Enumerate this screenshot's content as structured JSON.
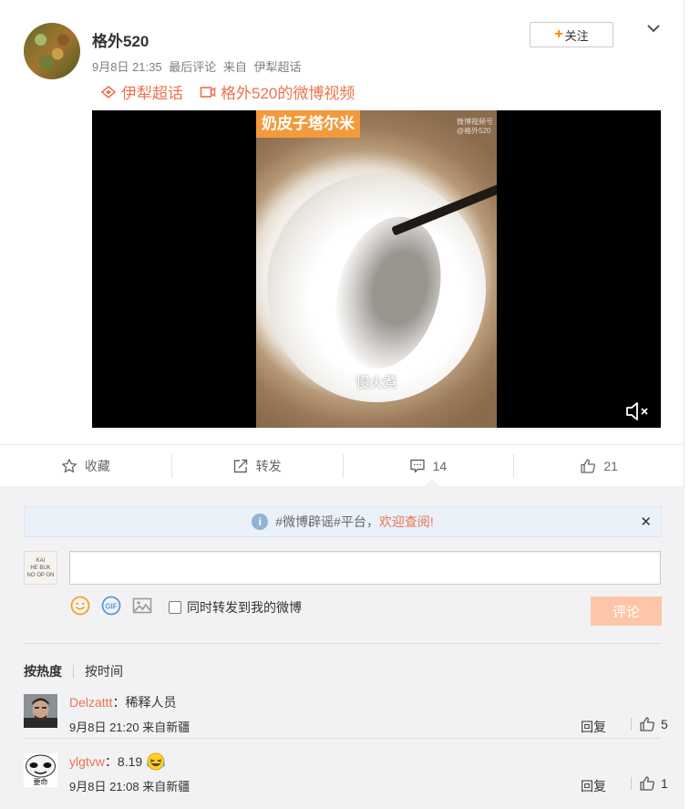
{
  "post": {
    "username": "格外520",
    "time": "9月8日 21:35",
    "last_comment": "最后评论",
    "source_prefix": "来自",
    "source": "伊犁超话",
    "follow_label": "关注",
    "tags": [
      {
        "label": "伊犁超话",
        "icon": "supertopic-icon"
      },
      {
        "label": "格外520的微博视频",
        "icon": "video-icon"
      }
    ],
    "video": {
      "title_overlay": "奶皮子塔尔米",
      "watermark": "微博视频号",
      "watermark_sub": "@格外520",
      "subtitle": "慢火煮",
      "muted": true
    }
  },
  "actions": {
    "favorite": "收藏",
    "repost": "转发",
    "comments": "14",
    "likes": "21"
  },
  "comment_box": {
    "notice_text": "#微博辟谣#平台，",
    "notice_link": "欢迎查阅!",
    "placeholder": "",
    "forward_label": "同时转发到我的微博",
    "submit_label": "评论",
    "my_avatar_lines": [
      "KAI",
      "HE BUK",
      "NO OP ON"
    ]
  },
  "sort": {
    "by_hot": "按热度",
    "by_time": "按时间"
  },
  "comments": [
    {
      "name": "Delzattt",
      "text": "稀释人员",
      "time": "9月8日 21:20",
      "location": "来自新疆",
      "reply": "回复",
      "likes": "5"
    },
    {
      "name": "ylgtvw",
      "text": "8.19",
      "time": "9月8日 21:08",
      "location": "来自新疆",
      "reply": "回复",
      "likes": "1",
      "avatar_caption": "要命"
    }
  ],
  "colors": {
    "accent": "#eb7350",
    "follow_plus": "#ff8200",
    "submit_disabled": "#fdc6a8",
    "comment_bg": "#f2f2f5",
    "notice_bg": "#eaf1f8"
  }
}
